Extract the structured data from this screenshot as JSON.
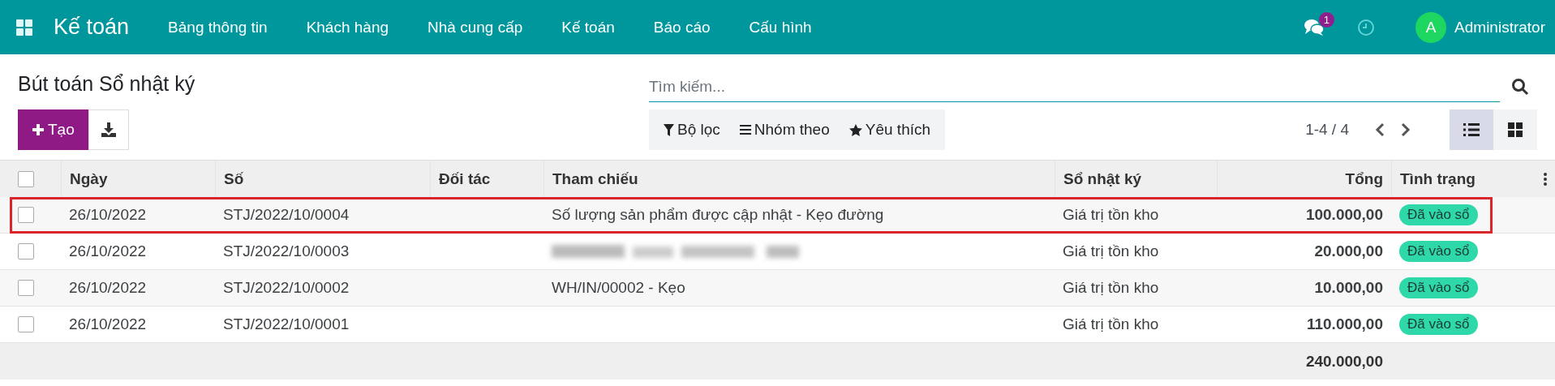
{
  "navbar": {
    "app_name": "Kế toán",
    "menu": [
      "Bảng thông tin",
      "Khách hàng",
      "Nhà cung cấp",
      "Kế toán",
      "Báo cáo",
      "Cấu hình"
    ],
    "message_count": "1",
    "user_initial": "A",
    "user_name": "Administrator"
  },
  "control_panel": {
    "title": "Bút toán Sổ nhật ký",
    "create_label": "Tạo",
    "search": {
      "placeholder": "Tìm kiếm..."
    },
    "filters": [
      "Bộ lọc",
      "Nhóm theo",
      "Yêu thích"
    ],
    "pager": "1-4 / 4",
    "views": [
      {
        "kind": "list",
        "selected": true
      },
      {
        "kind": "kanban",
        "selected": false
      }
    ]
  },
  "table": {
    "select_all_checked": false,
    "columns": [
      "Ngày",
      "Số",
      "Đối tác",
      "Tham chiếu",
      "Sổ nhật ký",
      "Tổng",
      "Tình trạng"
    ],
    "rows": [
      {
        "date": "26/10/2022",
        "number": "STJ/2022/10/0004",
        "reference": "Số lượng sản phẩm được cập nhật - Kẹo đường",
        "reference_redacted": false,
        "journal": "Giá trị tồn kho",
        "total": "100.000,00",
        "status": "Đã vào sổ",
        "highlighted": true,
        "checked": false
      },
      {
        "date": "26/10/2022",
        "number": "STJ/2022/10/0003",
        "reference_redacted": true,
        "journal": "Giá trị tồn kho",
        "total": "20.000,00",
        "status": "Đã vào sổ",
        "highlighted": false,
        "checked": false
      },
      {
        "date": "26/10/2022",
        "number": "STJ/2022/10/0002",
        "reference": "WH/IN/00002 - Kẹo",
        "reference_redacted": false,
        "journal": "Giá trị tồn kho",
        "total": "10.000,00",
        "status": "Đã vào sổ",
        "highlighted": false,
        "checked": false
      },
      {
        "date": "26/10/2022",
        "number": "STJ/2022/10/0001",
        "reference_redacted": false,
        "journal": "Giá trị tồn kho",
        "total": "110.000,00",
        "status": "Đã vào sổ",
        "highlighted": false,
        "checked": false
      }
    ],
    "footer_total": "240.000,00"
  }
}
